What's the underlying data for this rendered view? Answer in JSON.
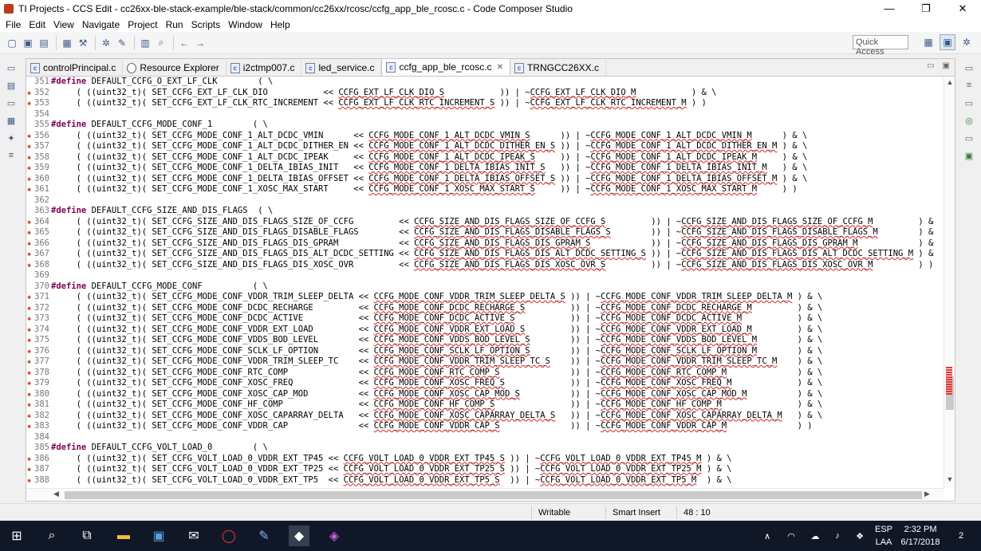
{
  "window": {
    "title": "TI Projects - CCS Edit - cc26xx-ble-stack-example/ble-stack/common/cc26xx/rcosc/ccfg_app_ble_rcosc.c - Code Composer Studio",
    "minimize": "—",
    "maximize": "❐",
    "close": "✕"
  },
  "menu": [
    "File",
    "Edit",
    "View",
    "Navigate",
    "Project",
    "Run",
    "Scripts",
    "Window",
    "Help"
  ],
  "quick_access": {
    "placeholder": "Quick Access"
  },
  "tabs": [
    {
      "label": "controlPrincipal.c",
      "icon": "c-file-icon"
    },
    {
      "label": "Resource Explorer",
      "icon": "resource-explorer-icon"
    },
    {
      "label": "i2ctmp007.c",
      "icon": "c-file-icon"
    },
    {
      "label": "led_service.c",
      "icon": "c-file-icon"
    },
    {
      "label": "ccfg_app_ble_rcosc.c",
      "icon": "c-file-icon",
      "active": true,
      "close": "✕"
    },
    {
      "label": "TRNGCC26XX.c",
      "icon": "c-file-icon"
    }
  ],
  "code_lines": [
    {
      "n": "351",
      "m": false,
      "t": "#define DEFAULT_CCFG_O_EXT_LF_CLK        ( \\"
    },
    {
      "n": "352",
      "m": true,
      "t": "     ( ((uint32_t)( SET_CCFG_EXT_LF_CLK_DIO           << CCFG_EXT_LF_CLK_DIO_S           )) | ~CCFG_EXT_LF_CLK_DIO_M           ) & \\"
    },
    {
      "n": "353",
      "m": true,
      "t": "     ( ((uint32_t)( SET_CCFG_EXT_LF_CLK_RTC_INCREMENT << CCFG_EXT_LF_CLK_RTC_INCREMENT_S )) | ~CCFG_EXT_LF_CLK_RTC_INCREMENT_M ) )"
    },
    {
      "n": "354",
      "m": false,
      "t": ""
    },
    {
      "n": "355",
      "m": false,
      "t": "#define DEFAULT_CCFG_MODE_CONF_1        ( \\"
    },
    {
      "n": "356",
      "m": true,
      "t": "     ( ((uint32_t)( SET_CCFG_MODE_CONF_1_ALT_DCDC_VMIN      << CCFG_MODE_CONF_1_ALT_DCDC_VMIN_S      )) | ~CCFG_MODE_CONF_1_ALT_DCDC_VMIN_M      ) & \\"
    },
    {
      "n": "357",
      "m": true,
      "t": "     ( ((uint32_t)( SET_CCFG_MODE_CONF_1_ALT_DCDC_DITHER_EN << CCFG_MODE_CONF_1_ALT_DCDC_DITHER_EN_S )) | ~CCFG_MODE_CONF_1_ALT_DCDC_DITHER_EN_M ) & \\"
    },
    {
      "n": "358",
      "m": true,
      "t": "     ( ((uint32_t)( SET_CCFG_MODE_CONF_1_ALT_DCDC_IPEAK     << CCFG_MODE_CONF_1_ALT_DCDC_IPEAK_S     )) | ~CCFG_MODE_CONF_1_ALT_DCDC_IPEAK_M     ) & \\"
    },
    {
      "n": "359",
      "m": true,
      "t": "     ( ((uint32_t)( SET_CCFG_MODE_CONF_1_DELTA_IBIAS_INIT   << CCFG_MODE_CONF_1_DELTA_IBIAS_INIT_S   )) | ~CCFG_MODE_CONF_1_DELTA_IBIAS_INIT_M   ) & \\"
    },
    {
      "n": "360",
      "m": true,
      "t": "     ( ((uint32_t)( SET_CCFG_MODE_CONF_1_DELTA_IBIAS_OFFSET << CCFG_MODE_CONF_1_DELTA_IBIAS_OFFSET_S )) | ~CCFG_MODE_CONF_1_DELTA_IBIAS_OFFSET_M ) & \\"
    },
    {
      "n": "361",
      "m": true,
      "t": "     ( ((uint32_t)( SET_CCFG_MODE_CONF_1_XOSC_MAX_START     << CCFG_MODE_CONF_1_XOSC_MAX_START_S     )) | ~CCFG_MODE_CONF_1_XOSC_MAX_START_M     ) )"
    },
    {
      "n": "362",
      "m": false,
      "t": ""
    },
    {
      "n": "363",
      "m": false,
      "t": "#define DEFAULT_CCFG_SIZE_AND_DIS_FLAGS  ( \\"
    },
    {
      "n": "364",
      "m": true,
      "t": "     ( ((uint32_t)( SET_CCFG_SIZE_AND_DIS_FLAGS_SIZE_OF_CCFG         << CCFG_SIZE_AND_DIS_FLAGS_SIZE_OF_CCFG_S         )) | ~CCFG_SIZE_AND_DIS_FLAGS_SIZE_OF_CCFG_M         ) &"
    },
    {
      "n": "365",
      "m": true,
      "t": "     ( ((uint32_t)( SET_CCFG_SIZE_AND_DIS_FLAGS_DISABLE_FLAGS        << CCFG_SIZE_AND_DIS_FLAGS_DISABLE_FLAGS_S        )) | ~CCFG_SIZE_AND_DIS_FLAGS_DISABLE_FLAGS_M        ) &"
    },
    {
      "n": "366",
      "m": true,
      "t": "     ( ((uint32_t)( SET_CCFG_SIZE_AND_DIS_FLAGS_DIS_GPRAM            << CCFG_SIZE_AND_DIS_FLAGS_DIS_GPRAM_S            )) | ~CCFG_SIZE_AND_DIS_FLAGS_DIS_GPRAM_M            ) &"
    },
    {
      "n": "367",
      "m": true,
      "t": "     ( ((uint32_t)( SET_CCFG_SIZE_AND_DIS_FLAGS_DIS_ALT_DCDC_SETTING << CCFG_SIZE_AND_DIS_FLAGS_DIS_ALT_DCDC_SETTING_S )) | ~CCFG_SIZE_AND_DIS_FLAGS_DIS_ALT_DCDC_SETTING_M ) &"
    },
    {
      "n": "368",
      "m": true,
      "t": "     ( ((uint32_t)( SET_CCFG_SIZE_AND_DIS_FLAGS_DIS_XOSC_OVR         << CCFG_SIZE_AND_DIS_FLAGS_DIS_XOSC_OVR_S         )) | ~CCFG_SIZE_AND_DIS_FLAGS_DIS_XOSC_OVR_M         ) )"
    },
    {
      "n": "369",
      "m": false,
      "t": ""
    },
    {
      "n": "370",
      "m": false,
      "t": "#define DEFAULT_CCFG_MODE_CONF          ( \\"
    },
    {
      "n": "371",
      "m": true,
      "t": "     ( ((uint32_t)( SET_CCFG_MODE_CONF_VDDR_TRIM_SLEEP_DELTA << CCFG_MODE_CONF_VDDR_TRIM_SLEEP_DELTA_S )) | ~CCFG_MODE_CONF_VDDR_TRIM_SLEEP_DELTA_M ) & \\"
    },
    {
      "n": "372",
      "m": true,
      "t": "     ( ((uint32_t)( SET_CCFG_MODE_CONF_DCDC_RECHARGE         << CCFG_MODE_CONF_DCDC_RECHARGE_S         )) | ~CCFG_MODE_CONF_DCDC_RECHARGE_M         ) & \\"
    },
    {
      "n": "373",
      "m": true,
      "t": "     ( ((uint32_t)( SET_CCFG_MODE_CONF_DCDC_ACTIVE           << CCFG_MODE_CONF_DCDC_ACTIVE_S           )) | ~CCFG_MODE_CONF_DCDC_ACTIVE_M           ) & \\"
    },
    {
      "n": "374",
      "m": true,
      "t": "     ( ((uint32_t)( SET_CCFG_MODE_CONF_VDDR_EXT_LOAD         << CCFG_MODE_CONF_VDDR_EXT_LOAD_S         )) | ~CCFG_MODE_CONF_VDDR_EXT_LOAD_M         ) & \\"
    },
    {
      "n": "375",
      "m": true,
      "t": "     ( ((uint32_t)( SET_CCFG_MODE_CONF_VDDS_BOD_LEVEL        << CCFG_MODE_CONF_VDDS_BOD_LEVEL_S        )) | ~CCFG_MODE_CONF_VDDS_BOD_LEVEL_M        ) & \\"
    },
    {
      "n": "376",
      "m": true,
      "t": "     ( ((uint32_t)( SET_CCFG_MODE_CONF_SCLK_LF_OPTION        << CCFG_MODE_CONF_SCLK_LF_OPTION_S        )) | ~CCFG_MODE_CONF_SCLK_LF_OPTION_M        ) & \\"
    },
    {
      "n": "377",
      "m": true,
      "t": "     ( ((uint32_t)( SET_CCFG_MODE_CONF_VDDR_TRIM_SLEEP_TC    << CCFG_MODE_CONF_VDDR_TRIM_SLEEP_TC_S    )) | ~CCFG_MODE_CONF_VDDR_TRIM_SLEEP_TC_M    ) & \\"
    },
    {
      "n": "378",
      "m": true,
      "t": "     ( ((uint32_t)( SET_CCFG_MODE_CONF_RTC_COMP              << CCFG_MODE_CONF_RTC_COMP_S              )) | ~CCFG_MODE_CONF_RTC_COMP_M              ) & \\"
    },
    {
      "n": "379",
      "m": true,
      "t": "     ( ((uint32_t)( SET_CCFG_MODE_CONF_XOSC_FREQ             << CCFG_MODE_CONF_XOSC_FREQ_S             )) | ~CCFG_MODE_CONF_XOSC_FREQ_M             ) & \\"
    },
    {
      "n": "380",
      "m": true,
      "t": "     ( ((uint32_t)( SET_CCFG_MODE_CONF_XOSC_CAP_MOD          << CCFG_MODE_CONF_XOSC_CAP_MOD_S          )) | ~CCFG_MODE_CONF_XOSC_CAP_MOD_M          ) & \\"
    },
    {
      "n": "381",
      "m": true,
      "t": "     ( ((uint32_t)( SET_CCFG_MODE_CONF_HF_COMP               << CCFG_MODE_CONF_HF_COMP_S               )) | ~CCFG_MODE_CONF_HF_COMP_M               ) & \\"
    },
    {
      "n": "382",
      "m": true,
      "t": "     ( ((uint32_t)( SET_CCFG_MODE_CONF_XOSC_CAPARRAY_DELTA   << CCFG_MODE_CONF_XOSC_CAPARRAY_DELTA_S   )) | ~CCFG_MODE_CONF_XOSC_CAPARRAY_DELTA_M   ) & \\"
    },
    {
      "n": "383",
      "m": true,
      "t": "     ( ((uint32_t)( SET_CCFG_MODE_CONF_VDDR_CAP              << CCFG_MODE_CONF_VDDR_CAP_S              )) | ~CCFG_MODE_CONF_VDDR_CAP_M              ) )"
    },
    {
      "n": "384",
      "m": false,
      "t": ""
    },
    {
      "n": "385",
      "m": false,
      "t": "#define DEFAULT_CCFG_VOLT_LOAD_0        ( \\"
    },
    {
      "n": "386",
      "m": true,
      "t": "     ( ((uint32_t)( SET_CCFG_VOLT_LOAD_0_VDDR_EXT_TP45 << CCFG_VOLT_LOAD_0_VDDR_EXT_TP45_S )) | ~CCFG_VOLT_LOAD_0_VDDR_EXT_TP45_M ) & \\"
    },
    {
      "n": "387",
      "m": true,
      "t": "     ( ((uint32_t)( SET_CCFG_VOLT_LOAD_0_VDDR_EXT_TP25 << CCFG_VOLT_LOAD_0_VDDR_EXT_TP25_S )) | ~CCFG_VOLT_LOAD_0_VDDR_EXT_TP25_M ) & \\"
    },
    {
      "n": "388",
      "m": true,
      "t": "     ( ((uint32_t)( SET_CCFG_VOLT_LOAD_0_VDDR_EXT_TP5  << CCFG_VOLT_LOAD_0_VDDR_EXT_TP5_S  )) | ~CCFG_VOLT_LOAD_0_VDDR_EXT_TP5_M  ) & \\"
    }
  ],
  "status": {
    "writable": "Writable",
    "insert_mode": "Smart Insert",
    "position": "48 : 10"
  },
  "taskbar": {
    "lang_top": "ESP",
    "lang_bottom": "LAA",
    "time": "2:32 PM",
    "date": "6/17/2018",
    "notifications": "2"
  },
  "colors": {
    "keyword": "#7f0055",
    "marker": "#c23a1e",
    "taskbar": "#101828"
  }
}
